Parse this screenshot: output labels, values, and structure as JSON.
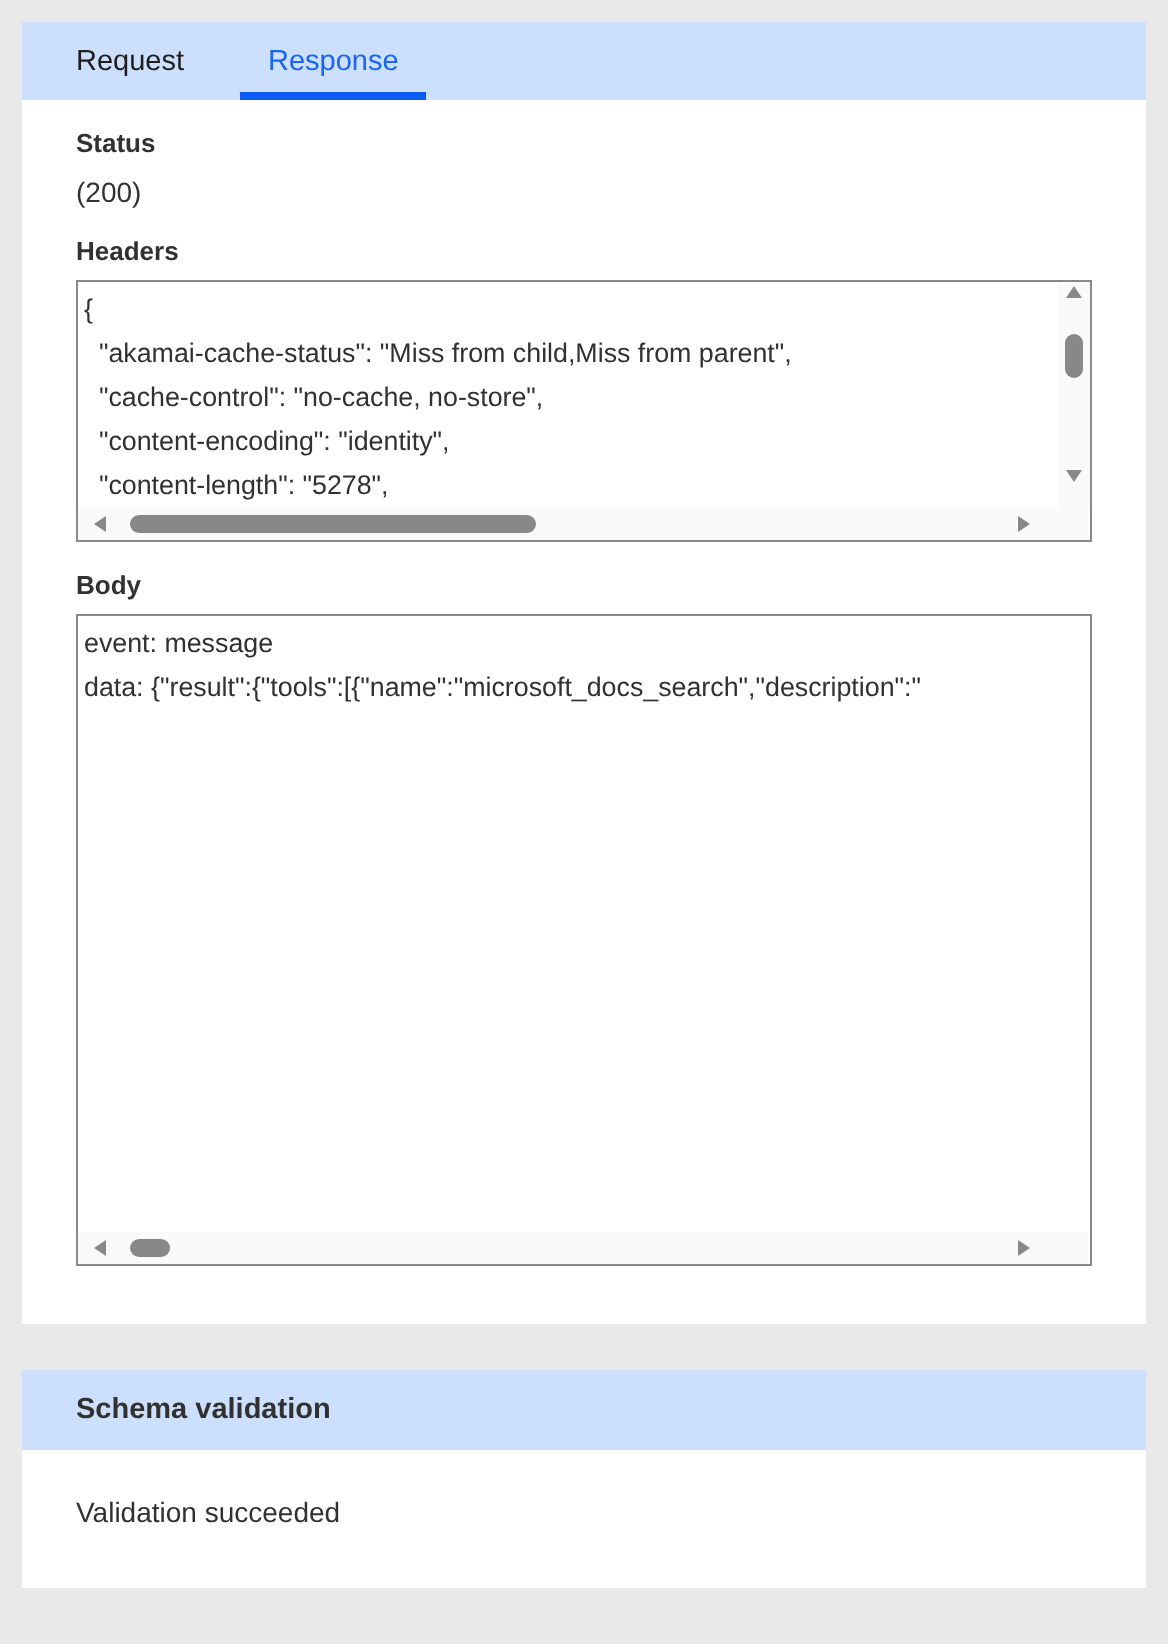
{
  "tabs": [
    {
      "label": "Request",
      "selected": false
    },
    {
      "label": "Response",
      "selected": true
    }
  ],
  "status": {
    "label": "Status",
    "value": " (200)"
  },
  "headers": {
    "label": "Headers",
    "lines": [
      "{",
      "  \"akamai-cache-status\": \"Miss from child,Miss from parent\",",
      "  \"cache-control\": \"no-cache, no-store\",",
      "  \"content-encoding\": \"identity\",",
      "  \"content-length\": \"5278\","
    ]
  },
  "body": {
    "label": "Body",
    "lines": [
      "event: message",
      "data: {\"result\":{\"tools\":[{\"name\":\"microsoft_docs_search\",\"description\":\""
    ]
  },
  "schema_validation": {
    "title": "Schema validation",
    "message": "Validation succeeded"
  }
}
